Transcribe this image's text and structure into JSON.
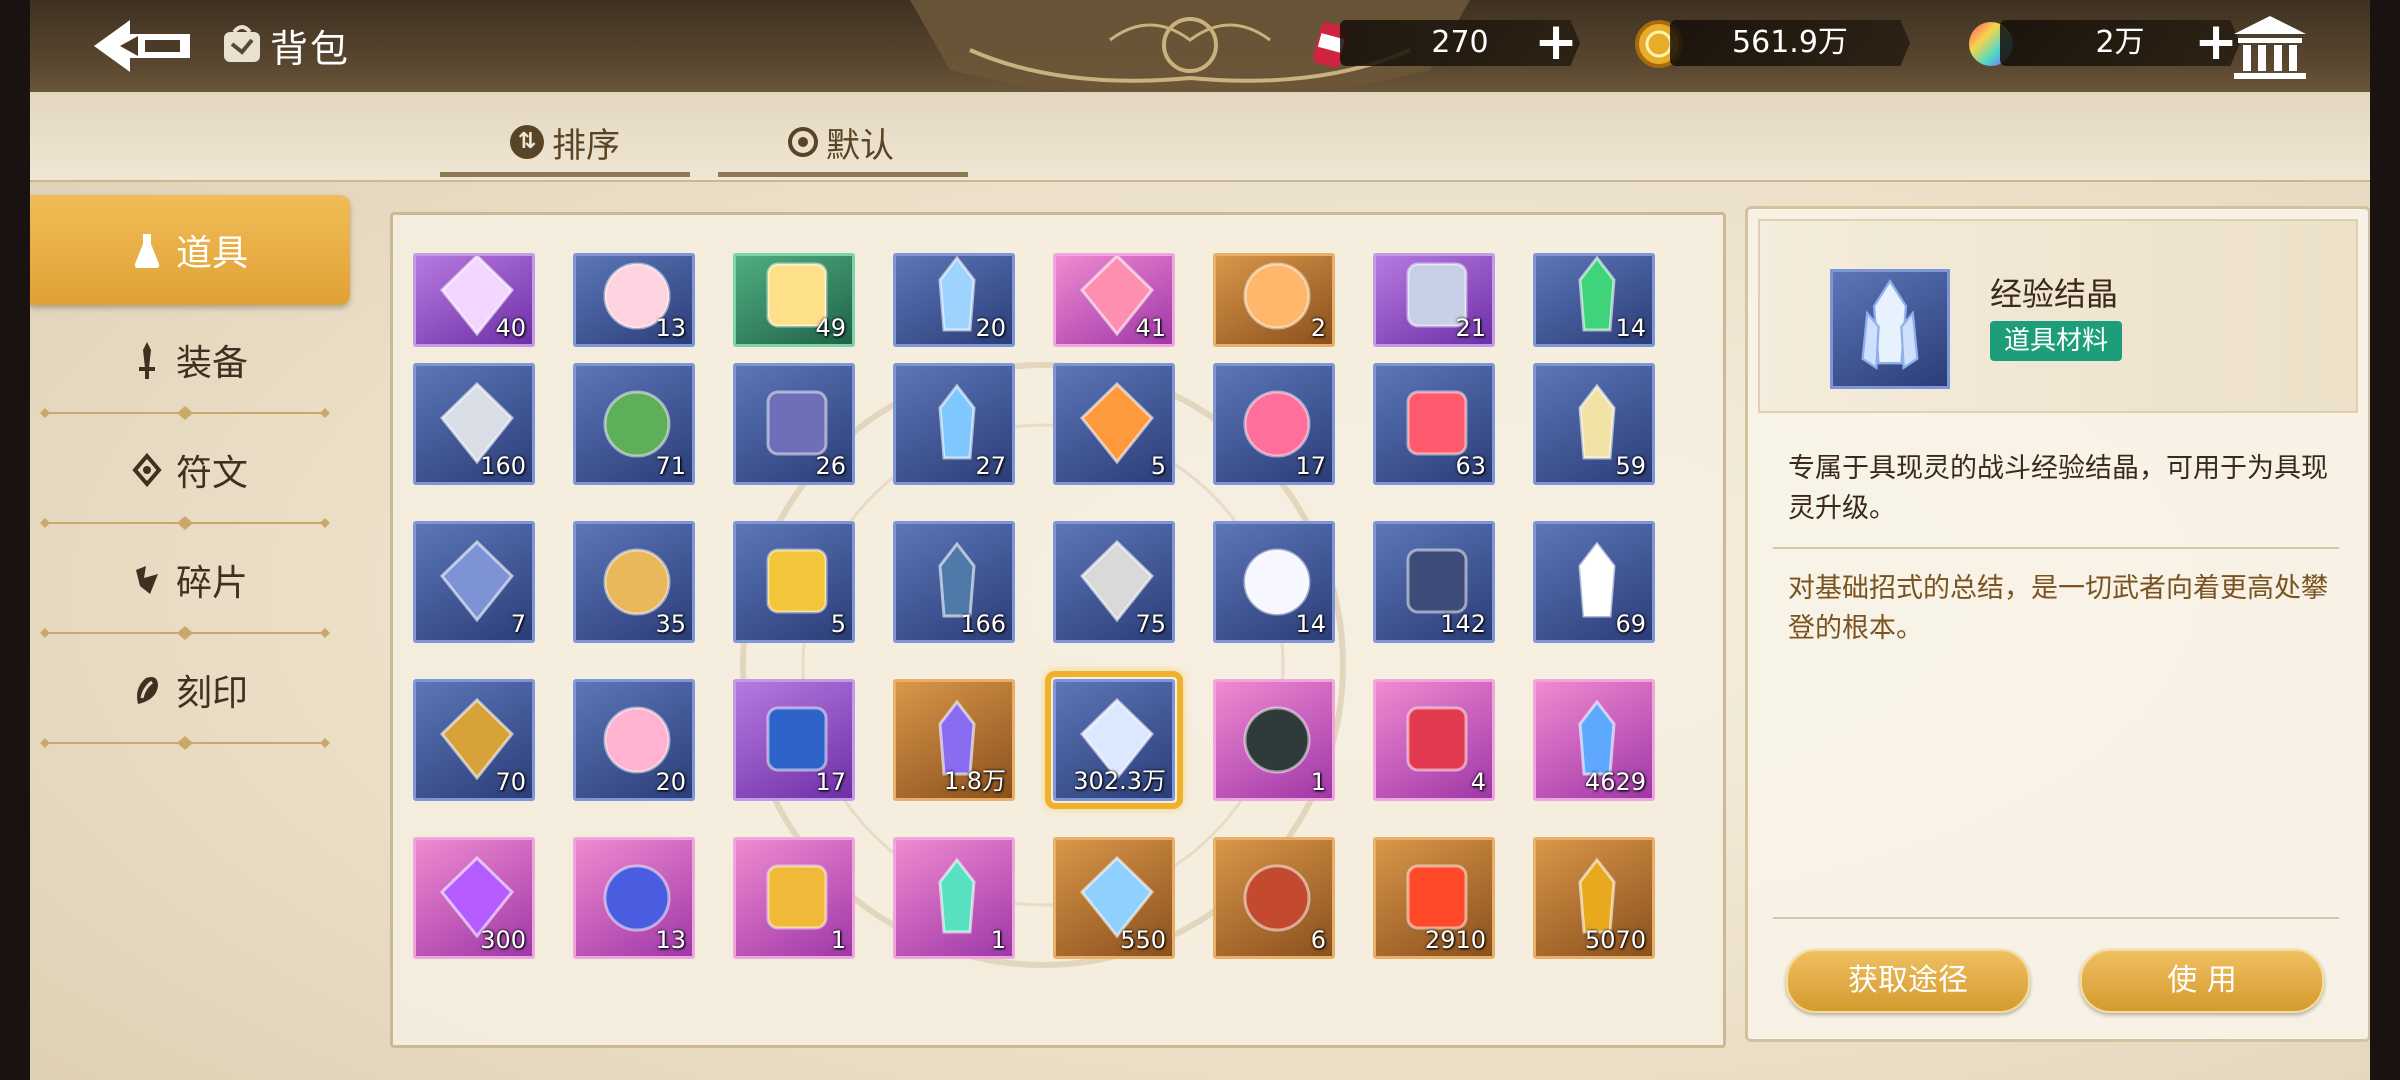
{
  "header": {
    "title": "背包",
    "currencies": [
      {
        "name": "stamina",
        "value": "270",
        "icon": "energy-can-icon"
      },
      {
        "name": "gold",
        "value": "561.9万",
        "icon": "gold-coin-icon"
      },
      {
        "name": "gems",
        "value": "2万",
        "icon": "rainbow-gem-icon"
      }
    ]
  },
  "subtabs": {
    "sort_label": "排序",
    "default_label": "默认"
  },
  "sidebar": {
    "items": [
      {
        "label": "道具",
        "active": true
      },
      {
        "label": "装备"
      },
      {
        "label": "符文"
      },
      {
        "label": "碎片"
      },
      {
        "label": "刻印"
      }
    ]
  },
  "inventory": {
    "rows": [
      [
        {
          "icon": "silhouette-card-icon",
          "count": "40",
          "rarity": "purple"
        },
        {
          "icon": "gift-box-icon",
          "count": "13",
          "rarity": "blue"
        },
        {
          "icon": "crystal-bowl-icon",
          "count": "49",
          "rarity": "green"
        },
        {
          "icon": "blue-potion-icon",
          "count": "20",
          "rarity": "blue"
        },
        {
          "icon": "flower-bouquet-icon",
          "count": "41",
          "rarity": "pink"
        },
        {
          "icon": "pink-block-icon",
          "count": "2",
          "rarity": "orange"
        },
        {
          "icon": "robot-doll-icon",
          "count": "21",
          "rarity": "purple"
        },
        {
          "icon": "green-crystal-icon",
          "count": "14",
          "rarity": "blue"
        }
      ],
      [
        {
          "icon": "grey-stone-icon",
          "count": "160",
          "rarity": "blue"
        },
        {
          "icon": "leaf-branch-icon",
          "count": "71",
          "rarity": "blue"
        },
        {
          "icon": "dark-ore-icon",
          "count": "26",
          "rarity": "blue"
        },
        {
          "icon": "water-bowl-icon",
          "count": "27",
          "rarity": "blue"
        },
        {
          "icon": "orange-flask-icon",
          "count": "5",
          "rarity": "blue"
        },
        {
          "icon": "pink-teapot-icon",
          "count": "17",
          "rarity": "blue"
        },
        {
          "icon": "red-jar-icon",
          "count": "63",
          "rarity": "blue"
        },
        {
          "icon": "grain-pile-icon",
          "count": "59",
          "rarity": "blue"
        }
      ],
      [
        {
          "icon": "blue-cloth-icon",
          "count": "7",
          "rarity": "blue"
        },
        {
          "icon": "potatoes-icon",
          "count": "35",
          "rarity": "blue"
        },
        {
          "icon": "golden-apple-icon",
          "count": "5",
          "rarity": "blue"
        },
        {
          "icon": "umbrella-icon",
          "count": "166",
          "rarity": "blue"
        },
        {
          "icon": "lighter-icon",
          "count": "75",
          "rarity": "blue"
        },
        {
          "icon": "open-book-icon",
          "count": "14",
          "rarity": "blue"
        },
        {
          "icon": "closed-book-icon",
          "count": "142",
          "rarity": "blue"
        },
        {
          "icon": "milk-carton-icon",
          "count": "69",
          "rarity": "blue"
        }
      ],
      [
        {
          "icon": "medal-icon",
          "count": "70",
          "rarity": "blue"
        },
        {
          "icon": "pink-pillow-icon",
          "count": "20",
          "rarity": "blue"
        },
        {
          "icon": "blue-chip-icon",
          "count": "17",
          "rarity": "purple"
        },
        {
          "icon": "purple-crystal-icon",
          "count": "1.8万",
          "rarity": "orange"
        },
        {
          "icon": "exp-crystal-icon",
          "count": "302.3万",
          "rarity": "blue",
          "selected": true
        },
        {
          "icon": "dark-dagger-icon",
          "count": "1",
          "rarity": "pink"
        },
        {
          "icon": "red-star-gem-icon",
          "count": "4",
          "rarity": "pink"
        },
        {
          "icon": "blue-cube-gem-icon",
          "count": "4629",
          "rarity": "pink"
        }
      ],
      [
        {
          "icon": "d20-dice-icon",
          "count": "300",
          "rarity": "pink"
        },
        {
          "icon": "fashion-card-icon",
          "count": "13",
          "rarity": "pink"
        },
        {
          "icon": "gold-flower-icon",
          "count": "1",
          "rarity": "pink"
        },
        {
          "icon": "rainbow-orb-icon",
          "count": "1",
          "rarity": "pink"
        },
        {
          "icon": "blue-pyramid-icon",
          "count": "550",
          "rarity": "orange"
        },
        {
          "icon": "dynamite-icon",
          "count": "6",
          "rarity": "orange"
        },
        {
          "icon": "red-crystal-icon",
          "count": "2910",
          "rarity": "orange"
        },
        {
          "icon": "gold-badge-icon",
          "count": "5070",
          "rarity": "orange"
        }
      ]
    ]
  },
  "detail": {
    "name": "经验结晶",
    "tag": "道具材料",
    "desc1": "专属于具现灵的战斗经验结晶，可用于为具现灵升级。",
    "desc2": "对基础招式的总结，是一切武者向着更高处攀登的根本。",
    "obtain_label": "获取途径",
    "use_label": "使 用"
  },
  "colors": {
    "accent": "#e0a136",
    "tag_green": "#1e9d7a",
    "header_dark": "#4a3a27"
  }
}
